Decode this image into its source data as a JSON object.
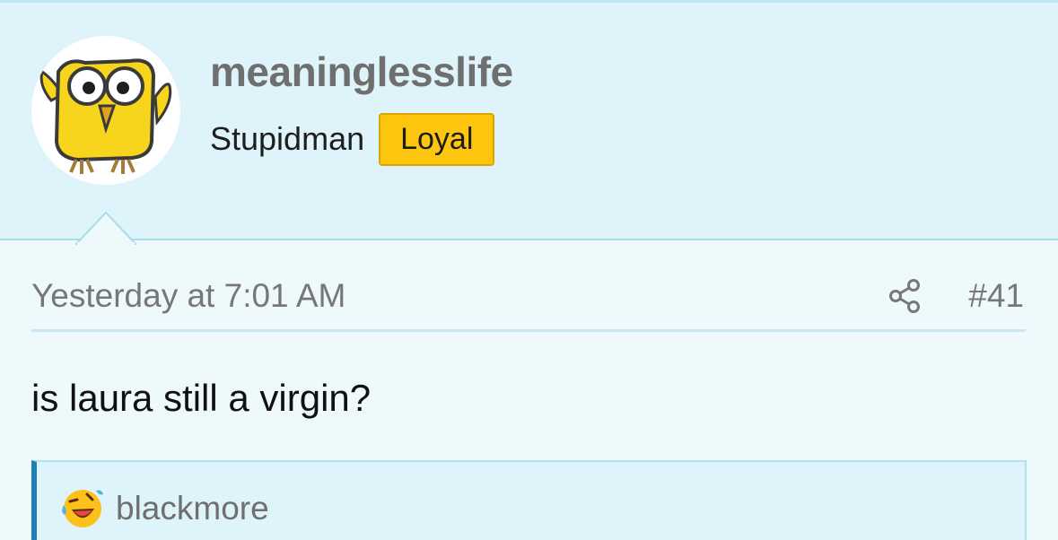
{
  "user": {
    "username": "meaninglesslife",
    "title": "Stupidman",
    "badge": "Loyal",
    "avatar_icon": "owl-avatar-icon"
  },
  "post": {
    "timestamp": "Yesterday at 7:01 AM",
    "number": "#41",
    "share_icon": "share-icon",
    "body": "is laura still a virgin?"
  },
  "reaction": {
    "emoji_icon": "laughing-emoji-icon",
    "username": "blackmore"
  },
  "colors": {
    "header_bg": "#def4fa",
    "page_bg": "#eef9fc",
    "badge_bg": "#fdc50e",
    "quote_accent": "#1e7fb6",
    "muted_text": "#777777"
  }
}
